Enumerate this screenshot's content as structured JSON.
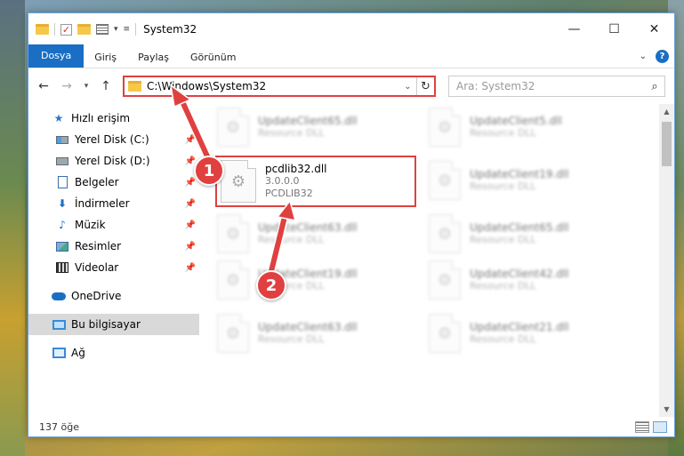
{
  "window": {
    "title": "System32",
    "controls": {
      "minimize": "—",
      "maximize": "☐",
      "close": "✕"
    }
  },
  "ribbon": {
    "tabs": [
      "Dosya",
      "Giriş",
      "Paylaş",
      "Görünüm"
    ],
    "help": "?"
  },
  "nav": {
    "address": "C:\\Windows\\System32",
    "search_placeholder": "Ara: System32"
  },
  "sidebar": {
    "quick_access": "Hızlı erişim",
    "items": [
      {
        "label": "Yerel Disk (C:)",
        "icon": "drive-c-icon"
      },
      {
        "label": "Yerel Disk (D:)",
        "icon": "drive-d-icon"
      },
      {
        "label": "Belgeler",
        "icon": "documents-icon"
      },
      {
        "label": "İndirmeler",
        "icon": "downloads-icon"
      },
      {
        "label": "Müzik",
        "icon": "music-icon"
      },
      {
        "label": "Resimler",
        "icon": "pictures-icon"
      },
      {
        "label": "Videolar",
        "icon": "videos-icon"
      }
    ],
    "onedrive": "OneDrive",
    "this_pc": "Bu bilgisayar",
    "network": "Ağ"
  },
  "files": [
    {
      "name": "UpdateClient65.dll",
      "sub1": "Resource DLL",
      "sub2": "",
      "col": 0,
      "row": 0
    },
    {
      "name": "UpdateClient5.dll",
      "sub1": "Resource DLL",
      "sub2": "",
      "col": 1,
      "row": 0
    },
    {
      "name": "pcdlib32.dll",
      "sub1": "3.0.0.0",
      "sub2": "PCDLIB32",
      "col": 0,
      "row": 1,
      "highlight": true
    },
    {
      "name": "UpdateClient19.dll",
      "sub1": "Resource DLL",
      "sub2": "",
      "col": 1,
      "row": 1
    },
    {
      "name": "UpdateClient63.dll",
      "sub1": "Resource DLL",
      "sub2": "",
      "col": 0,
      "row": 2
    },
    {
      "name": "UpdateClient65.dll",
      "sub1": "Resource DLL",
      "sub2": "",
      "col": 1,
      "row": 2
    },
    {
      "name": "UpdateClient19.dll",
      "sub1": "Resource DLL",
      "sub2": "",
      "col": 0,
      "row": 3
    },
    {
      "name": "UpdateClient42.dll",
      "sub1": "Resource DLL",
      "sub2": "",
      "col": 1,
      "row": 3
    },
    {
      "name": "UpdateClient63.dll",
      "sub1": "Resource DLL",
      "sub2": "",
      "col": 0,
      "row": 4
    },
    {
      "name": "UpdateClient21.dll",
      "sub1": "Resource DLL",
      "sub2": "",
      "col": 1,
      "row": 4
    }
  ],
  "status": {
    "count": "137 öğe"
  },
  "annotations": [
    {
      "label": "1"
    },
    {
      "label": "2"
    }
  ],
  "colors": {
    "accent": "#1a6fc4",
    "highlight": "#e04040"
  }
}
